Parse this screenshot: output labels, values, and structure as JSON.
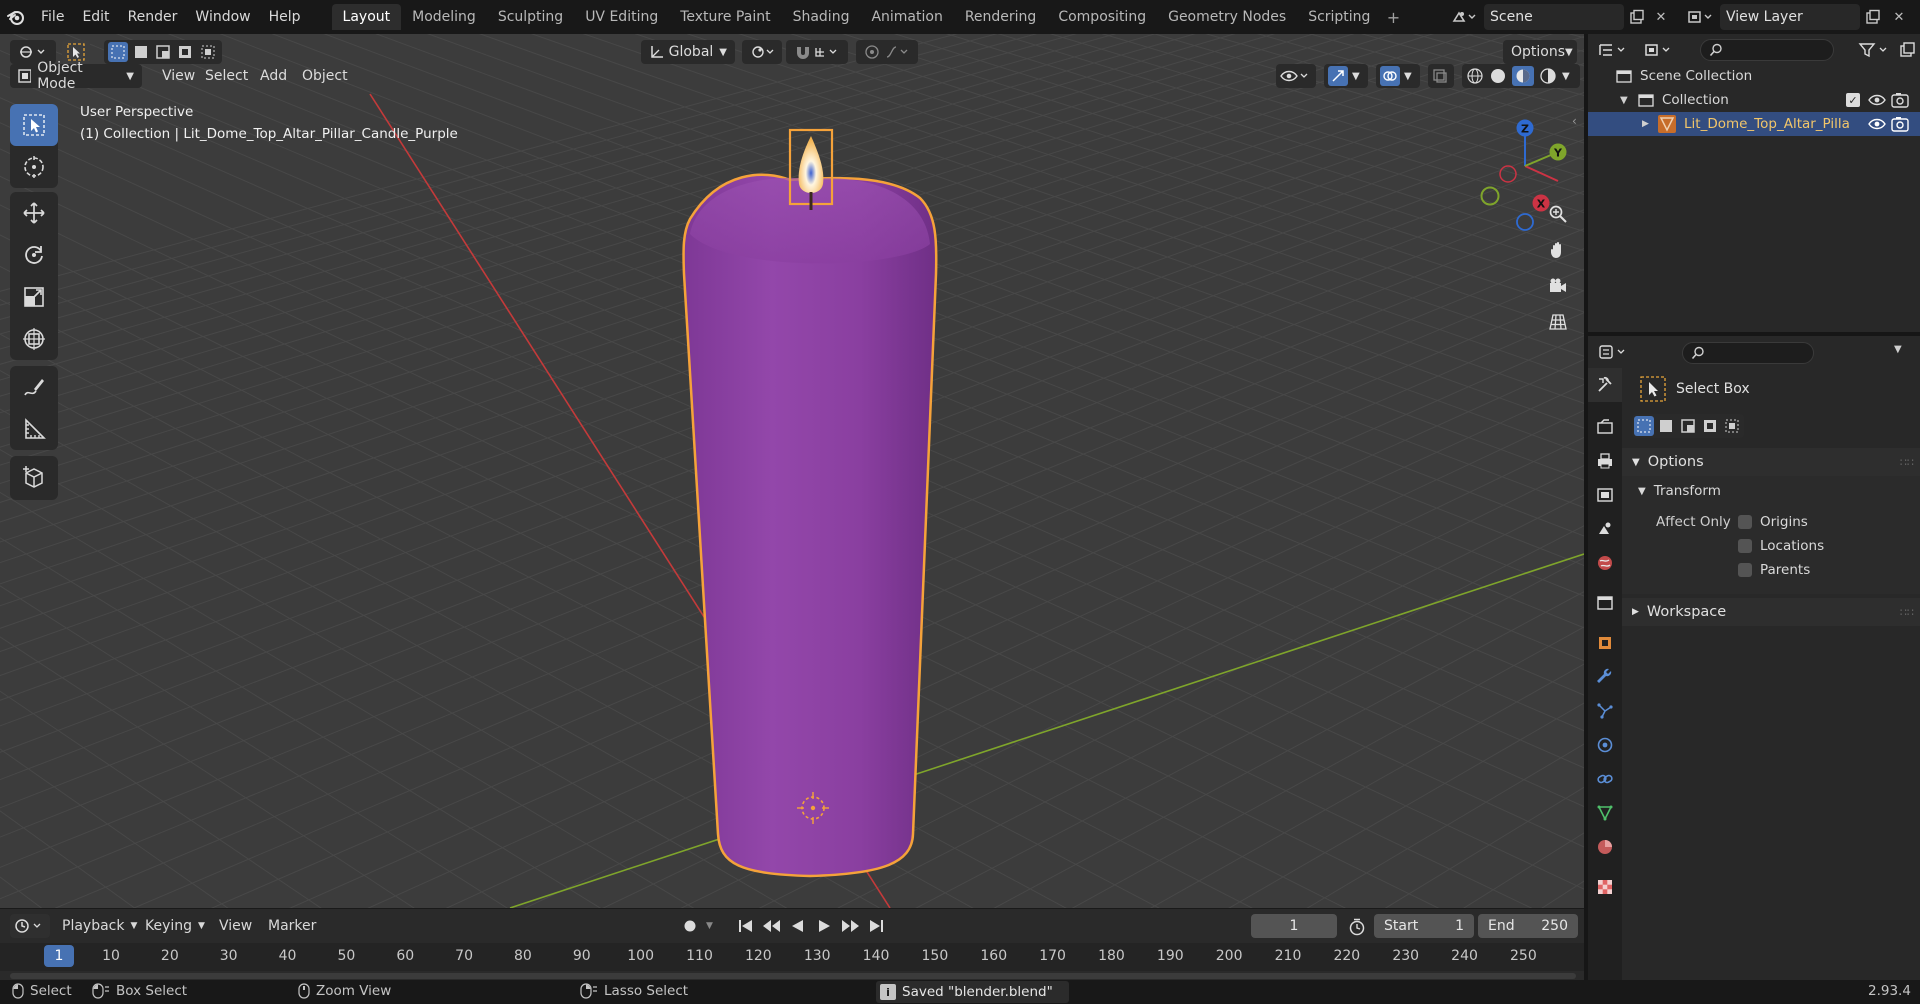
{
  "menu": {
    "items": [
      "File",
      "Edit",
      "Render",
      "Window",
      "Help"
    ],
    "workspaces": [
      "Layout",
      "Modeling",
      "Sculpting",
      "UV Editing",
      "Texture Paint",
      "Shading",
      "Animation",
      "Rendering",
      "Compositing",
      "Geometry Nodes",
      "Scripting"
    ],
    "active_workspace": "Layout",
    "scene": "Scene",
    "view_layer": "View Layer"
  },
  "viewport": {
    "mode": "Object Mode",
    "menus": [
      "View",
      "Select",
      "Add",
      "Object"
    ],
    "orientation": "Global",
    "options_label": "Options",
    "perspective_label": "User Perspective",
    "collection_label": "(1) Collection | Lit_Dome_Top_Altar_Pillar_Candle_Purple",
    "gizmo_axes": {
      "z": "Z",
      "y": "Y",
      "x": "X"
    },
    "colors": {
      "background": "#3c3c3c",
      "candle": "#8a3fa0",
      "selection_outline": "#f5a23a",
      "x_axis": "#c33a3a",
      "y_axis": "#7fa52b"
    }
  },
  "timeline": {
    "menus": [
      "Playback",
      "Keying",
      "View",
      "Marker"
    ],
    "current_frame": "1",
    "start_label": "Start",
    "start_value": "1",
    "end_label": "End",
    "end_value": "250",
    "ticks": [
      "1",
      "10",
      "20",
      "30",
      "40",
      "50",
      "60",
      "70",
      "80",
      "90",
      "100",
      "110",
      "120",
      "130",
      "140",
      "150",
      "160",
      "170",
      "180",
      "190",
      "200",
      "210",
      "220",
      "230",
      "240",
      "250"
    ]
  },
  "statusbar": {
    "select": "Select",
    "box_select": "Box Select",
    "zoom_view": "Zoom View",
    "lasso_select": "Lasso Select",
    "message": "Saved \"blender.blend\"",
    "version": "2.93.4"
  },
  "outliner": {
    "scene_collection": "Scene Collection",
    "collection": "Collection",
    "object": "Lit_Dome_Top_Altar_Pilla"
  },
  "properties": {
    "tool_name": "Select Box",
    "options_label": "Options",
    "transform_label": "Transform",
    "affect_only_label": "Affect Only",
    "checkboxes": [
      "Origins",
      "Locations",
      "Parents"
    ],
    "workspace_label": "Workspace"
  }
}
